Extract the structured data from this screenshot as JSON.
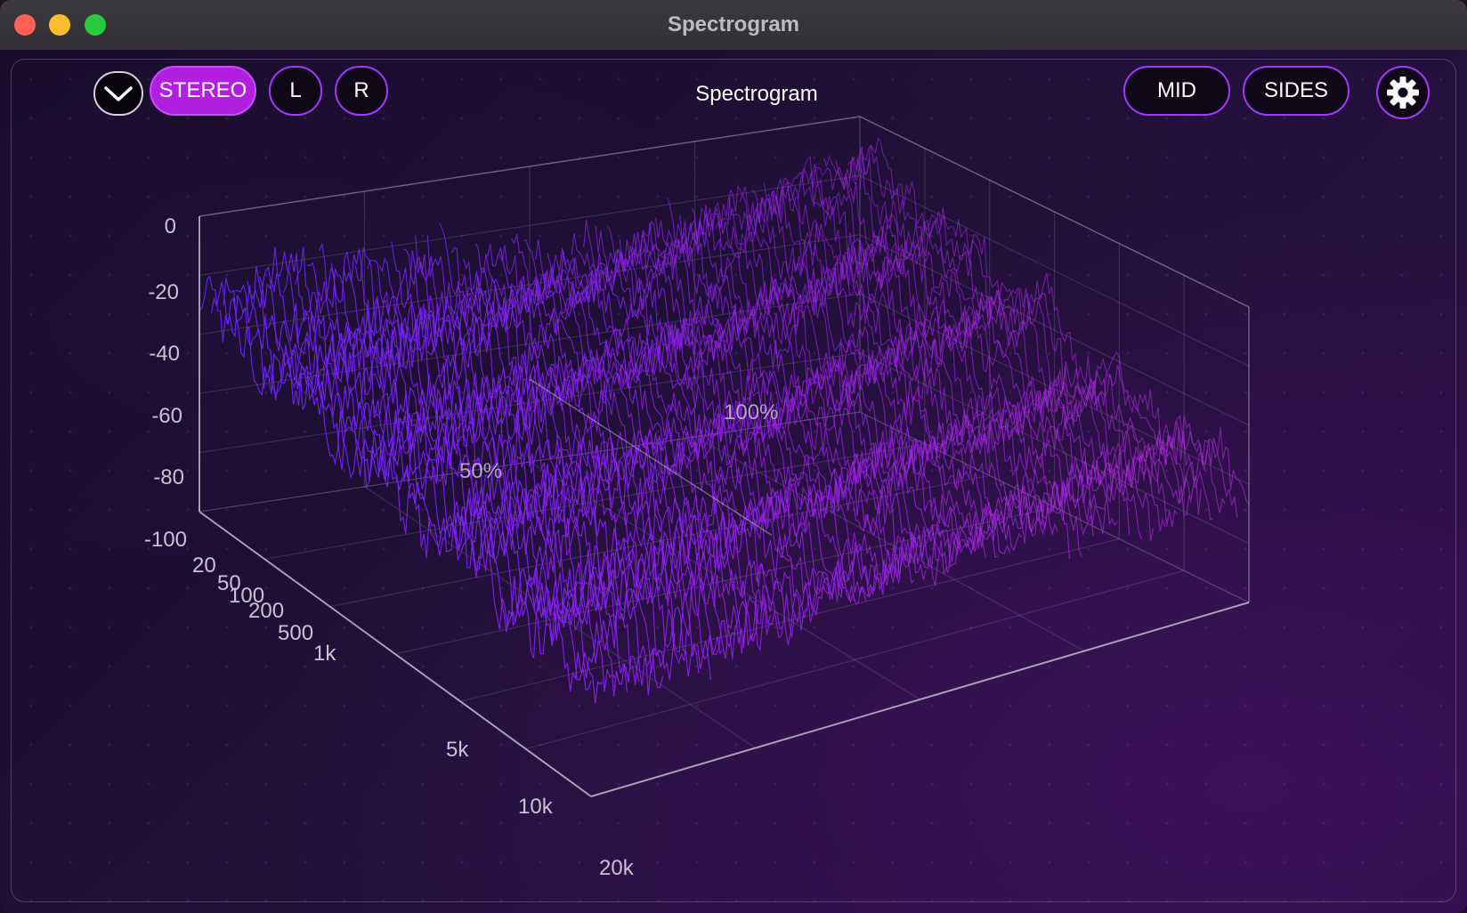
{
  "window": {
    "title": "Spectrogram"
  },
  "toolbar": {
    "dropdown_icon": "chevron-down-icon",
    "buttons": [
      {
        "id": "stereo",
        "label": "STEREO",
        "active": true
      },
      {
        "id": "left",
        "label": "L",
        "active": false
      },
      {
        "id": "right",
        "label": "R",
        "active": false
      },
      {
        "id": "mid",
        "label": "MID",
        "active": false
      },
      {
        "id": "sides",
        "label": "SIDES",
        "active": false
      }
    ],
    "title": "Spectrogram",
    "settings_icon": "gear-icon"
  },
  "colors": {
    "accent": "#a438ff",
    "active_button": "#b31fe0",
    "surface_low_freq": "#6a22ff",
    "surface_high_freq": "#c02ee6"
  },
  "plot": {
    "db_ticks": [
      "0",
      "-20",
      "-40",
      "-60",
      "-80",
      "-100"
    ],
    "freq_ticks": [
      "20",
      "50",
      "100",
      "200",
      "500",
      "1k",
      "5k",
      "10k",
      "20k"
    ],
    "time_ticks": [
      "50%",
      "100%"
    ]
  }
}
